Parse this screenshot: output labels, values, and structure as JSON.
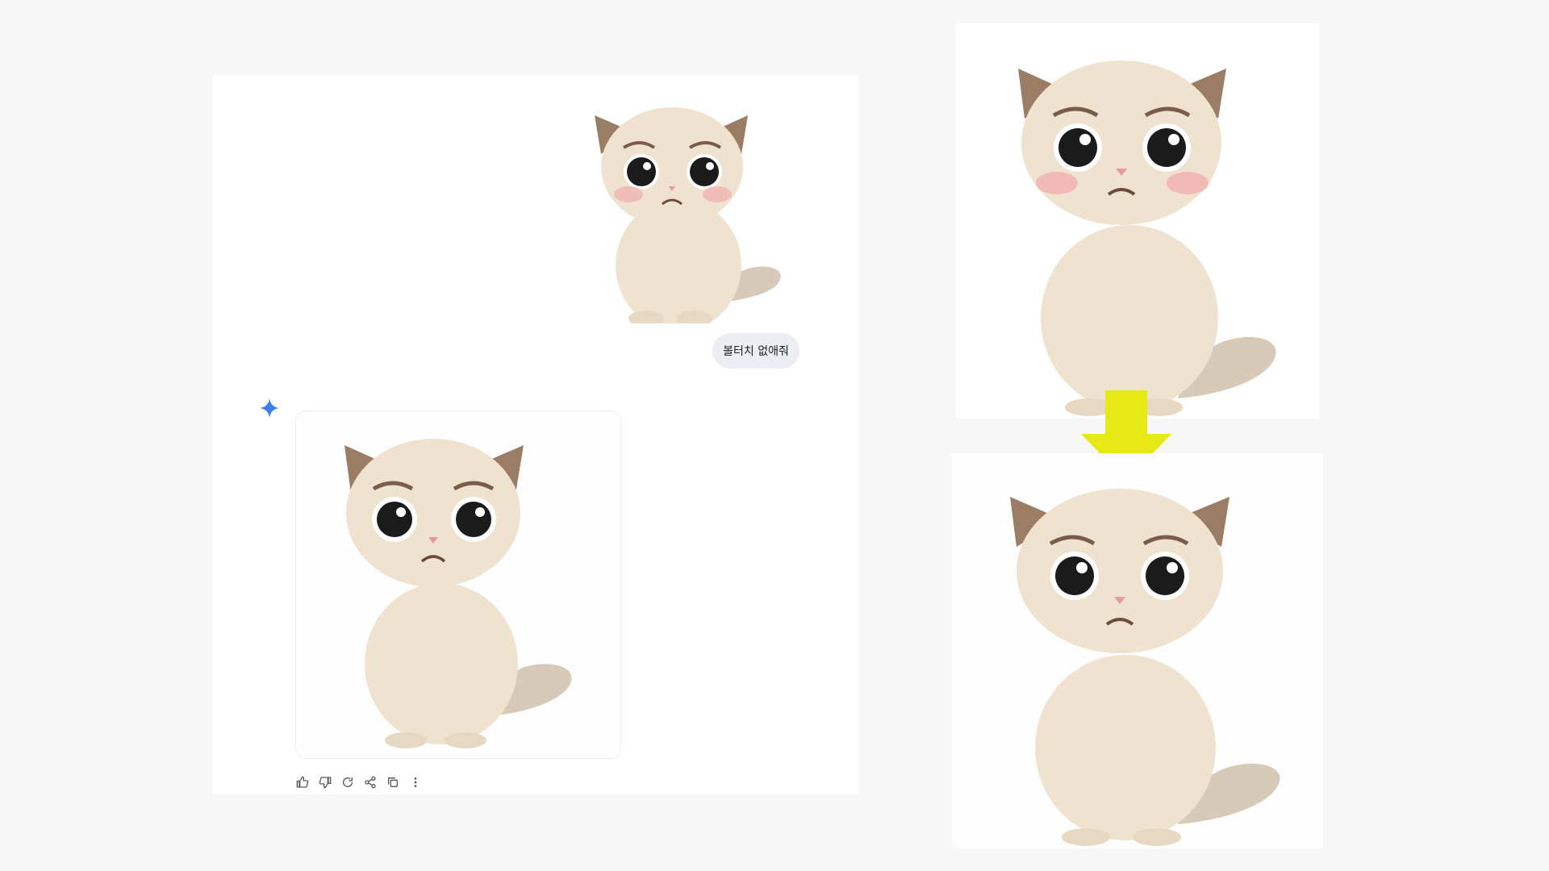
{
  "chat": {
    "user_message": "볼터치 없애줘"
  },
  "colors": {
    "arrow": "#e6e916",
    "spark": "#3b7dea",
    "cat_fur": "#efe3cf",
    "cat_ear": "#9b7d66",
    "cheek_blush": "#f1b3b0"
  },
  "icons": [
    "thumbs-up-icon",
    "thumbs-down-icon",
    "regenerate-icon",
    "share-icon",
    "copy-icon",
    "more-icon"
  ]
}
